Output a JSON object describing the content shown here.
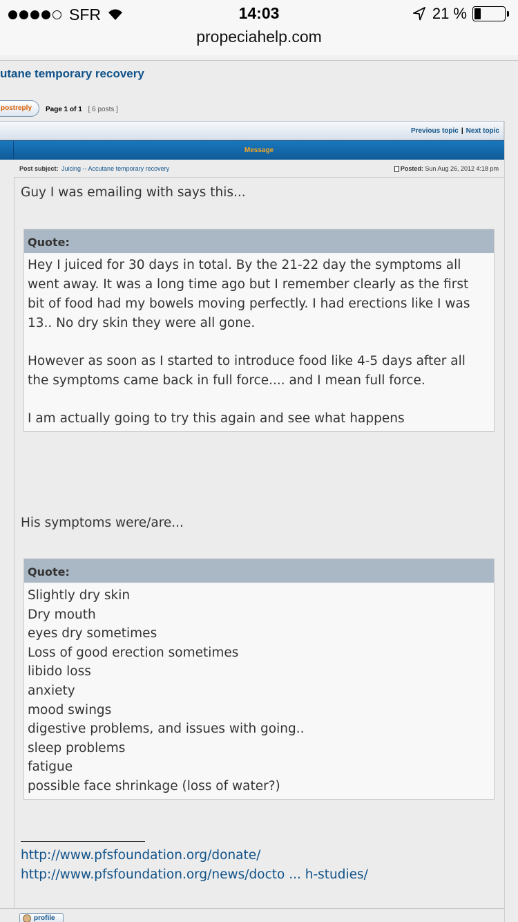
{
  "status_bar": {
    "carrier": "SFR",
    "time": "14:03",
    "battery": "21 %",
    "battery_level": 0.21,
    "url": "propeciahelp.com"
  },
  "topic": {
    "title": "utane temporary recovery",
    "post_reply_label": "postreply",
    "page_label": "Page 1 of 1",
    "post_count": "[ 6 posts ]",
    "previous_topic": "Previous topic",
    "separator": "|",
    "next_topic": "Next topic"
  },
  "table": {
    "header": "Message",
    "subject_label": "Post subject:",
    "subject_value": "Juicing -- Accutane temporary recovery",
    "posted_label": "Posted:",
    "posted_value": "Sun Aug 26, 2012 4:18 pm"
  },
  "post": {
    "intro": "Guy I was emailing with says this...",
    "quote1": {
      "label": "Quote:",
      "paragraphs": [
        "Hey I juiced for 30 days in total. By the 21-22 day the symptoms all went away. It was a long time ago but I remember clearly as the first bit of food had my bowels moving perfectly. I had erections like I was 13.. No dry skin they were all gone.",
        "However as soon as I started to introduce food like 4-5 days after all the symptoms came back in full force.... and I mean full force.",
        "I am actually going to try this again and see what happens"
      ]
    },
    "middle": "His symptoms were/are...",
    "quote2": {
      "label": "Quote:",
      "items": [
        "Slightly dry skin",
        "Dry mouth",
        "eyes dry sometimes",
        "Loss of good erection sometimes",
        "libido loss",
        "anxiety",
        "mood swings",
        "digestive problems, and issues with going..",
        "sleep problems",
        "fatigue",
        "possible face shrinkage (loss of water?)"
      ]
    },
    "signature_links": [
      "http://www.pfsfoundation.org/donate/",
      "http://www.pfsfoundation.org/news/docto ... h-studies/"
    ]
  },
  "footer": {
    "profile_label": "profile"
  }
}
